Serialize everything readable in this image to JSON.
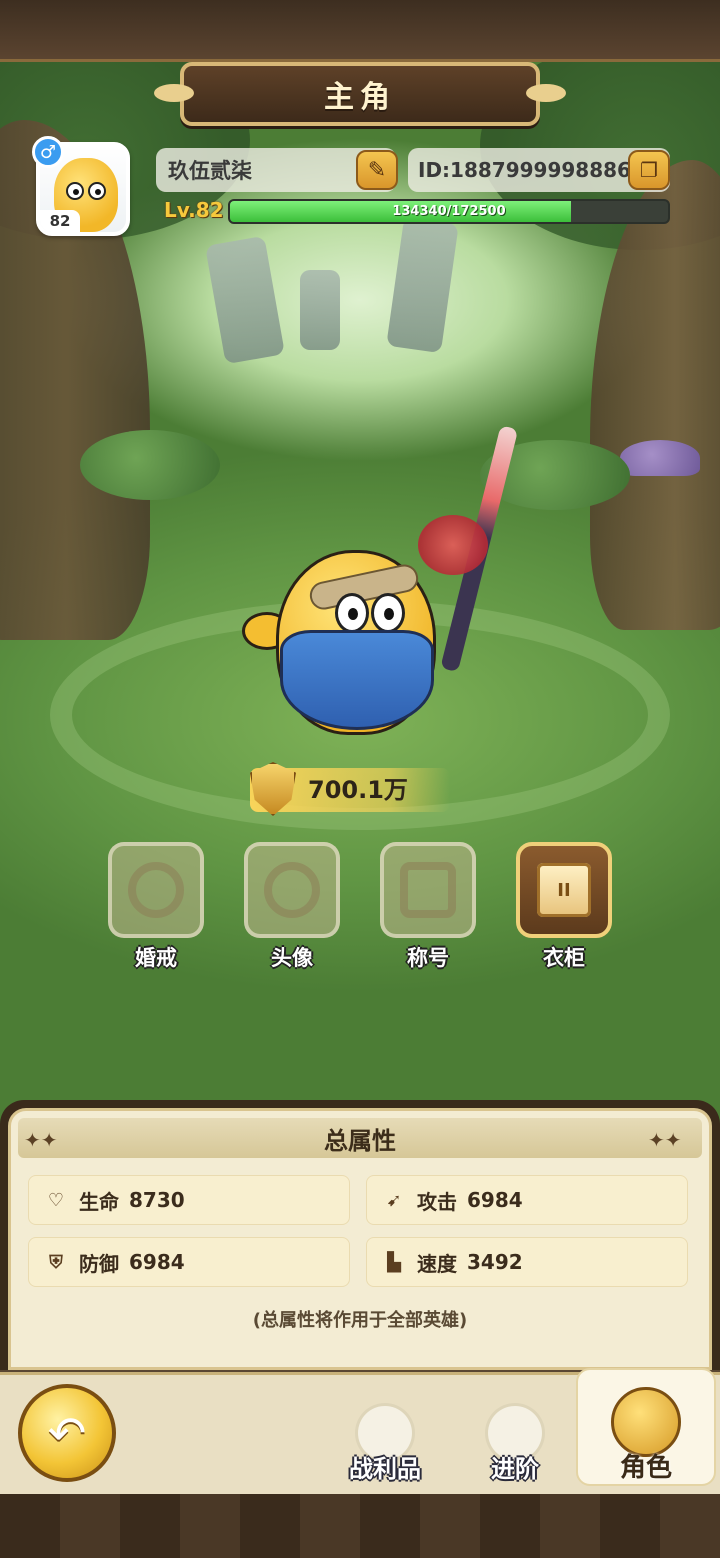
{
  "header": {
    "title": "主角"
  },
  "profile": {
    "avatar_level": "82",
    "gender_symbol": "♂",
    "name": "玖伍贰柒",
    "edit_icon": "pencil-icon",
    "id_text": "ID:1887999998886",
    "copy_icon": "copy-icon",
    "level_label": "Lv.82",
    "xp_text": "134340/172500",
    "xp_fraction": 0.779
  },
  "power": {
    "value": "700.1万",
    "icon": "sword-shield-icon"
  },
  "features": [
    {
      "label": "婚戒",
      "icon": "ring-icon",
      "active": false
    },
    {
      "label": "头像",
      "icon": "portrait-icon",
      "active": false
    },
    {
      "label": "称号",
      "icon": "crown-banner-icon",
      "active": false
    },
    {
      "label": "衣柜",
      "icon": "wardrobe-icon",
      "active": true
    }
  ],
  "attributes": {
    "title": "总属性",
    "stats": [
      {
        "name": "生命",
        "value": "8730",
        "icon": "heart-icon"
      },
      {
        "name": "攻击",
        "value": "6984",
        "icon": "attack-icon"
      },
      {
        "name": "防御",
        "value": "6984",
        "icon": "shield-icon"
      },
      {
        "name": "速度",
        "value": "3492",
        "icon": "boot-icon"
      }
    ],
    "note": "(总属性将作用于全部英雄)"
  },
  "nav": {
    "back_icon": "back-arrow-icon",
    "tabs": [
      {
        "label": "战利品",
        "icon": "loot-icon"
      },
      {
        "label": "进阶",
        "icon": "advance-icon"
      },
      {
        "label": "角色",
        "icon": "character-icon",
        "active": true
      }
    ]
  },
  "colors": {
    "accent_gold": "#f3c536",
    "xp_green": "#3cbf3a",
    "frame_brown": "#3a2a1b",
    "panel_cream": "#f3ecd3"
  }
}
